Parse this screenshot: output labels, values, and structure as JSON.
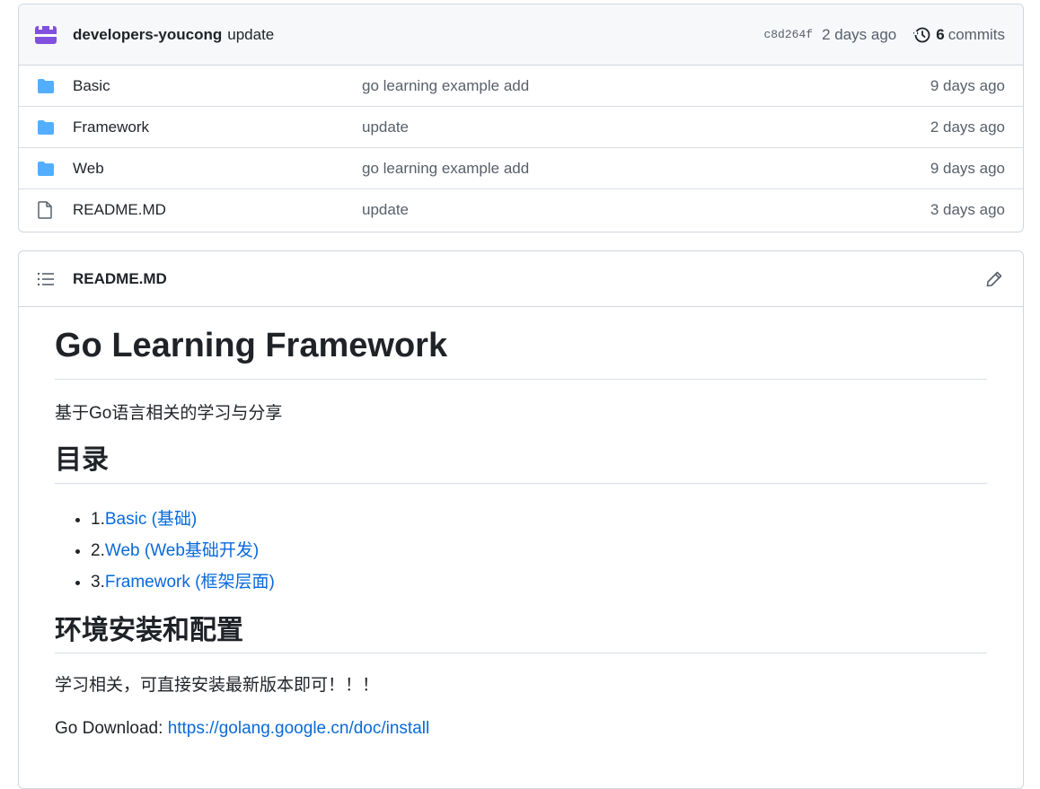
{
  "commit": {
    "author": "developers-youcong",
    "message": "update",
    "sha": "c8d264f",
    "ago": "2 days ago",
    "commit_count": "6",
    "commits_label": "commits"
  },
  "files": [
    {
      "name": "Basic",
      "type": "folder",
      "message": "go learning example add",
      "date": "9 days ago"
    },
    {
      "name": "Framework",
      "type": "folder",
      "message": "update",
      "date": "2 days ago"
    },
    {
      "name": "Web",
      "type": "folder",
      "message": "go learning example add",
      "date": "9 days ago"
    },
    {
      "name": "README.MD",
      "type": "file",
      "message": "update",
      "date": "3 days ago"
    }
  ],
  "readme": {
    "header_title": "README.MD",
    "h1": "Go Learning Framework",
    "intro": "基于Go语言相关的学习与分享",
    "toc_heading": "目录",
    "toc": [
      {
        "prefix": "1.",
        "link": "Basic (基础)"
      },
      {
        "prefix": "2.",
        "link": "Web (Web基础开发)"
      },
      {
        "prefix": "3.",
        "link": "Framework (框架层面)"
      }
    ],
    "env_heading": "环境安装和配置",
    "env_text": "学习相关，可直接安装最新版本即可！！！",
    "download_label": "Go Download: ",
    "download_link": "https://golang.google.cn/doc/install"
  },
  "colors": {
    "link": "#0969da",
    "folder": "#54aeff",
    "avatar": "#8250df"
  }
}
